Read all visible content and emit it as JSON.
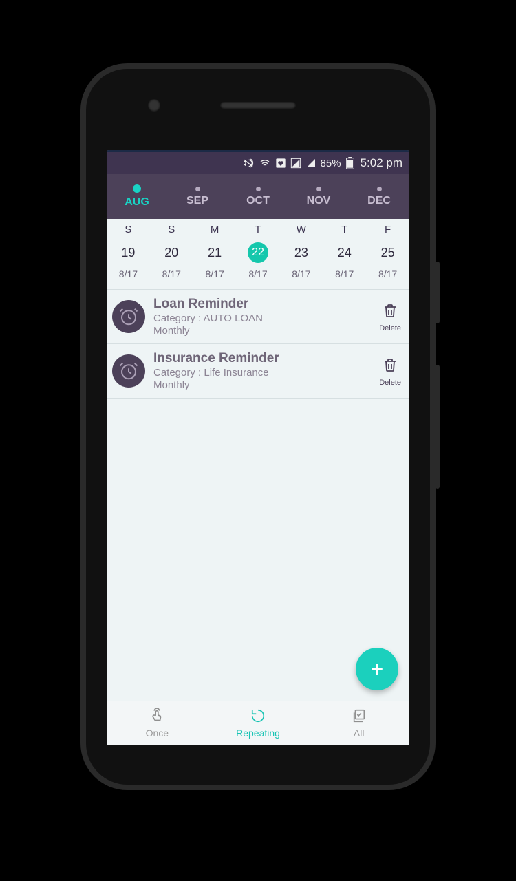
{
  "status": {
    "battery_pct": "85%",
    "time": "5:02 pm"
  },
  "months": [
    {
      "label": "AUG",
      "active": true
    },
    {
      "label": "SEP",
      "active": false
    },
    {
      "label": "OCT",
      "active": false
    },
    {
      "label": "NOV",
      "active": false
    },
    {
      "label": "DEC",
      "active": false
    }
  ],
  "weekdays": [
    "S",
    "S",
    "M",
    "T",
    "W",
    "T",
    "F"
  ],
  "days": [
    "19",
    "20",
    "21",
    "22",
    "23",
    "24",
    "25"
  ],
  "selected_day_index": 3,
  "daysub": [
    "8/17",
    "8/17",
    "8/17",
    "8/17",
    "8/17",
    "8/17",
    "8/17"
  ],
  "reminders": [
    {
      "title": "Loan Reminder",
      "category_label": "Category : AUTO LOAN",
      "freq": "Monthly",
      "delete_label": "Delete"
    },
    {
      "title": "Insurance Reminder",
      "category_label": "Category : Life Insurance",
      "freq": "Monthly",
      "delete_label": "Delete"
    }
  ],
  "fab": {
    "glyph": "+"
  },
  "tabs": [
    {
      "label": "Once",
      "active": false
    },
    {
      "label": "Repeating",
      "active": true
    },
    {
      "label": "All",
      "active": false
    }
  ]
}
